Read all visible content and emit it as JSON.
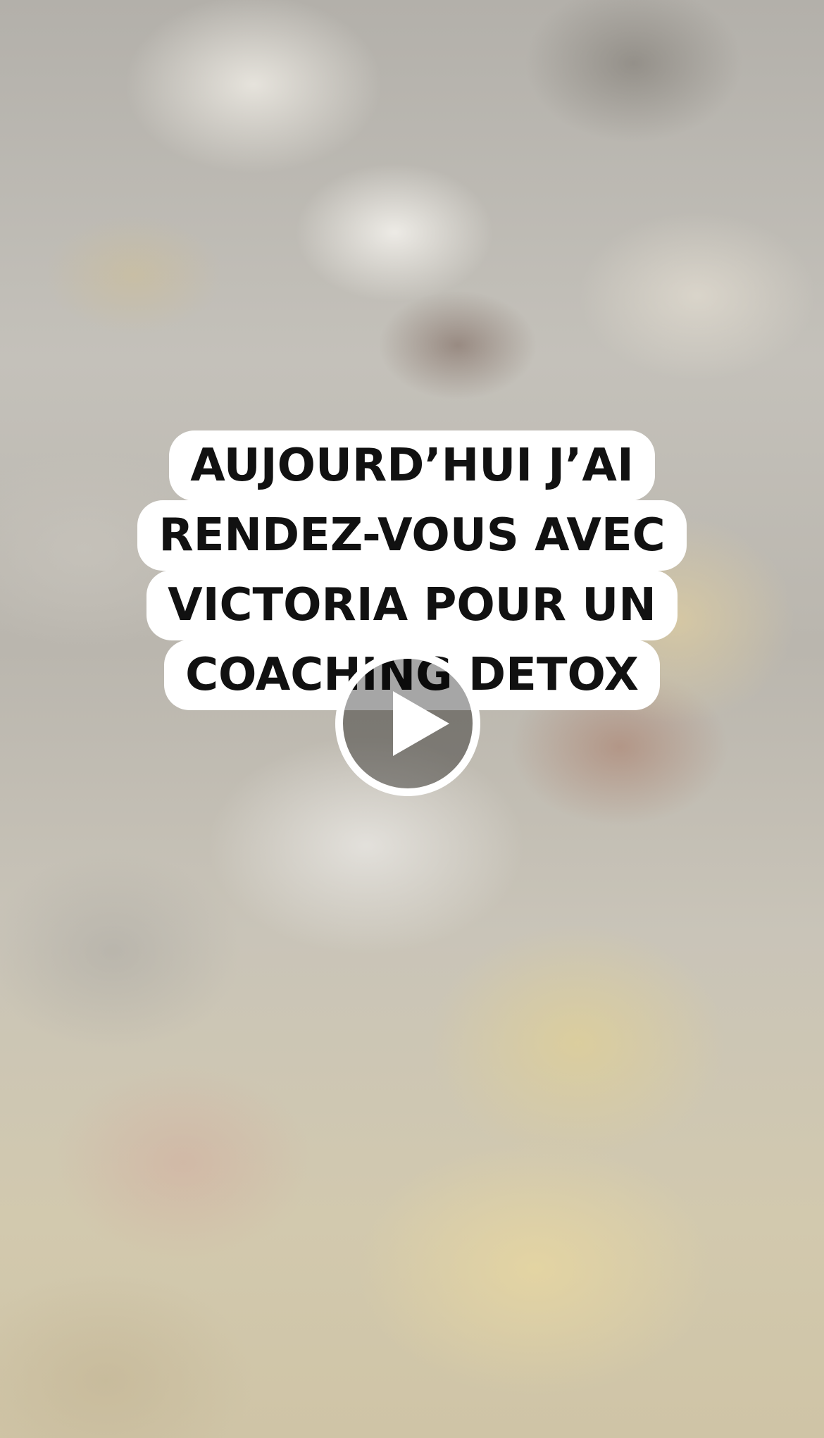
{
  "video": {
    "caption_lines": [
      "AUJOURD’HUI J’AI",
      "RENDEZ-VOUS AVEC",
      "VICTORIA POUR UN",
      "COACHING DETOX"
    ],
    "play_icon": "play-icon"
  }
}
